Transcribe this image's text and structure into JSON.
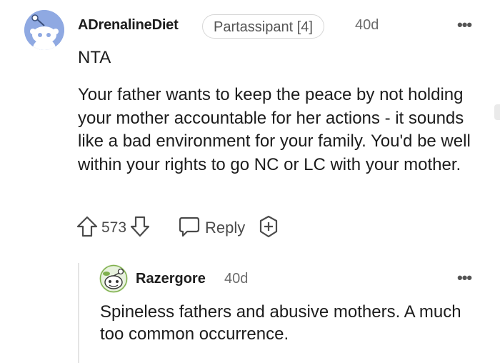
{
  "comment": {
    "author": "ADrenalineDiet",
    "flair": "Partassipant [4]",
    "age": "40d",
    "more_label": "•••",
    "tag": "NTA",
    "body": "Your father wants to keep the peace by not holding your mother accountable for her actions - it sounds like a bad environment for your family. You'd be well within your rights to go NC or LC with your mother.",
    "votes": "573",
    "reply_label": "Reply",
    "icons": [
      "avatar-snoo",
      "upvote-arrow",
      "downvote-arrow",
      "reply-bubble",
      "award-plus",
      "more-dots"
    ]
  },
  "reply": {
    "author": "Razergore",
    "age": "40d",
    "more_label": "•••",
    "body": "Spineless fathers and abusive mothers. A much too common occurrence.",
    "icons": [
      "avatar-snoo",
      "more-dots"
    ]
  },
  "colors": {
    "avatar_bg": "#8fa9e2",
    "text": "#1c1c1c",
    "meta": "#6c6c6c",
    "action": "#4a4a4a",
    "thread_line": "#e4e4e4"
  }
}
